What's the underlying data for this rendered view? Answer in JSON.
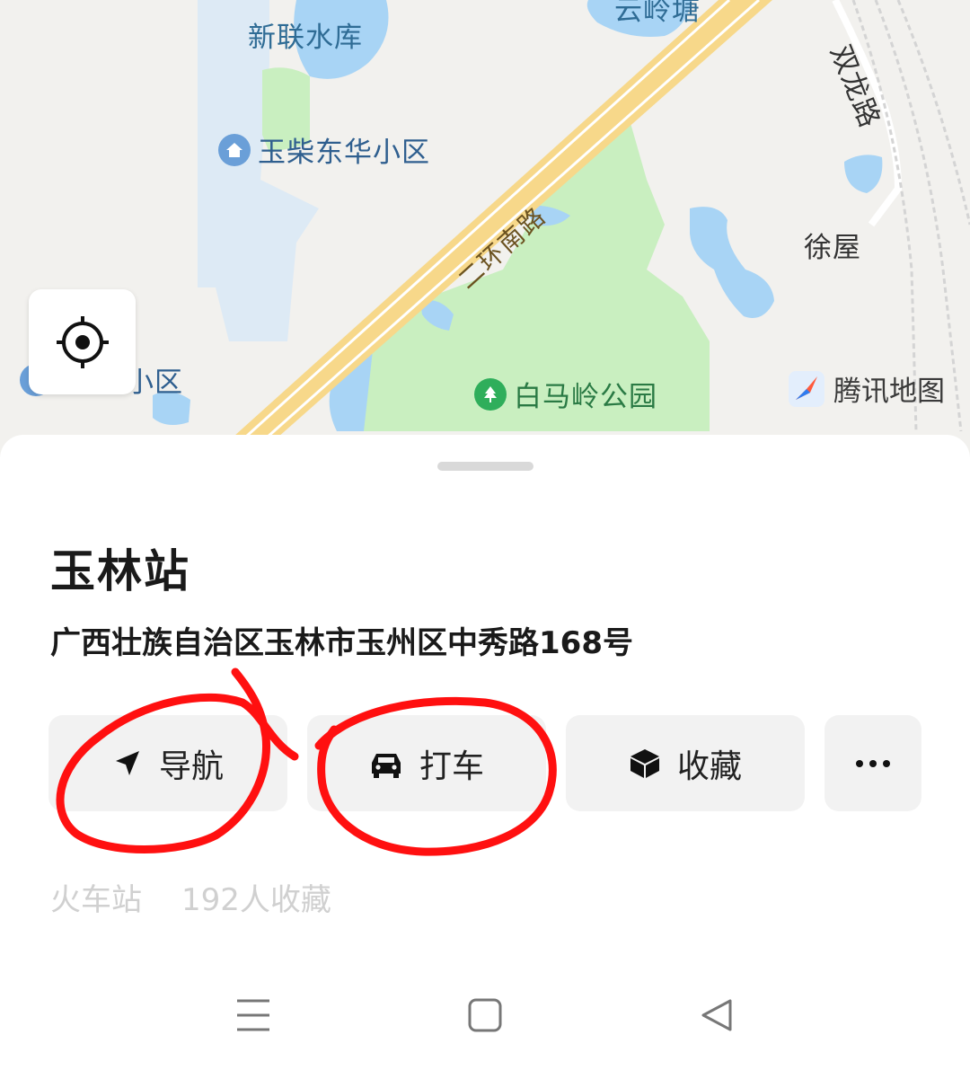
{
  "map": {
    "labels": {
      "reservoir": "新联水库",
      "pond_top": "云岭塘",
      "road_shuanglong": "双龙路",
      "xuwu": "徐屋",
      "road_erhuan": "二环南路",
      "partial_xiaoqu": "小区"
    },
    "pois": {
      "residence": "玉柴东华小区",
      "park": "白马岭公园"
    },
    "logo_text": "腾讯地图",
    "colors": {
      "land": "#f2f1ee",
      "water": "#a8d4f5",
      "green": "#c9efc0",
      "road": "#f7d88a",
      "poi_blue": "#6a9fd8",
      "poi_green": "#2fae5b"
    }
  },
  "place": {
    "name": "玉林站",
    "address": "广西壮族自治区玉林市玉州区中秀路168号",
    "category": "火车站",
    "favorites": "192人收藏"
  },
  "actions": {
    "navigate": "导航",
    "taxi": "打车",
    "favorite": "收藏",
    "more_icon": "more-horizontal-icon"
  },
  "annotation_color": "#ff1010"
}
